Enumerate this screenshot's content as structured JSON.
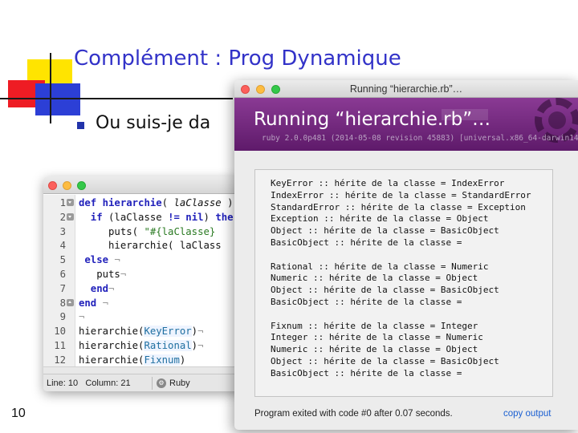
{
  "slide": {
    "title": "Complément : Prog Dynamique",
    "bullet": "Ou suis-je da",
    "page_number": "10",
    "title_color": "#3232c8"
  },
  "editor": {
    "lines": [
      {
        "num": "1",
        "fold": "down",
        "code": [
          {
            "t": "def ",
            "c": "kw"
          },
          {
            "t": "hierarchie",
            "c": "kw"
          },
          {
            "t": "( ",
            "c": ""
          },
          {
            "t": "laClasse",
            "c": "it"
          },
          {
            "t": " )",
            "c": ""
          }
        ]
      },
      {
        "num": "2",
        "fold": "down",
        "code": [
          {
            "t": "  if ",
            "c": "kw"
          },
          {
            "t": "(laClasse ",
            "c": ""
          },
          {
            "t": "!= nil",
            "c": "kw"
          },
          {
            "t": ") ",
            "c": ""
          },
          {
            "t": "the",
            "c": "kw"
          }
        ]
      },
      {
        "num": "3",
        "fold": "",
        "code": [
          {
            "t": "     puts( ",
            "c": ""
          },
          {
            "t": "\"#{laClasse}",
            "c": "str"
          }
        ]
      },
      {
        "num": "4",
        "fold": "",
        "code": [
          {
            "t": "     hierarchie( laClass",
            "c": ""
          }
        ]
      },
      {
        "num": "5",
        "fold": "",
        "code": [
          {
            "t": " else",
            "c": "kw"
          },
          {
            "t": " ¬",
            "c": "inv"
          }
        ]
      },
      {
        "num": "6",
        "fold": "",
        "code": [
          {
            "t": "   puts",
            "c": ""
          },
          {
            "t": "¬",
            "c": "inv"
          }
        ]
      },
      {
        "num": "7",
        "fold": "",
        "code": [
          {
            "t": "  end",
            "c": "kw"
          },
          {
            "t": "¬",
            "c": "inv"
          }
        ]
      },
      {
        "num": "8",
        "fold": "up",
        "code": [
          {
            "t": "end",
            "c": "kw"
          },
          {
            "t": " ¬",
            "c": "inv"
          }
        ]
      },
      {
        "num": "9",
        "fold": "",
        "code": [
          {
            "t": "¬",
            "c": "inv"
          }
        ]
      },
      {
        "num": "10",
        "fold": "",
        "code": [
          {
            "t": "hierarchie(",
            "c": ""
          },
          {
            "t": "KeyError",
            "c": "cls"
          },
          {
            "t": ")",
            "c": ""
          },
          {
            "t": "¬",
            "c": "inv"
          }
        ]
      },
      {
        "num": "11",
        "fold": "",
        "code": [
          {
            "t": "hierarchie(",
            "c": ""
          },
          {
            "t": "Rational",
            "c": "cls"
          },
          {
            "t": ")",
            "c": ""
          },
          {
            "t": "¬",
            "c": "inv"
          }
        ]
      },
      {
        "num": "12",
        "fold": "",
        "code": [
          {
            "t": "hierarchie(",
            "c": ""
          },
          {
            "t": "Fixnum",
            "c": "cls"
          },
          {
            "t": ")",
            "c": ""
          }
        ]
      }
    ],
    "status": {
      "position": "Line: 10   Column: 21",
      "language": "Ruby",
      "language_icon": "cog-icon"
    }
  },
  "runner": {
    "window_title": "Running “hierarchie.rb”…",
    "heading": "Running “hierarchie.rb”…",
    "subtitle": "ruby 2.0.0p481 (2014-05-08 revision 45883) [universal.x86_64-darwin14]",
    "header_color": "#6e2a7a",
    "output_lines": [
      "KeyError :: hérite de la classe = IndexError",
      "IndexError :: hérite de la classe = StandardError",
      "StandardError :: hérite de la classe = Exception",
      "Exception :: hérite de la classe = Object",
      "Object :: hérite de la classe = BasicObject",
      "BasicObject :: hérite de la classe =",
      "",
      "Rational :: hérite de la classe = Numeric",
      "Numeric :: hérite de la classe = Object",
      "Object :: hérite de la classe = BasicObject",
      "BasicObject :: hérite de la classe =",
      "",
      "Fixnum :: hérite de la classe = Integer",
      "Integer :: hérite de la classe = Numeric",
      "Numeric :: hérite de la classe = Object",
      "Object :: hérite de la classe = BasicObject",
      "BasicObject :: hérite de la classe ="
    ],
    "exit_message": "Program exited with code #0 after 0.07 seconds.",
    "copy_output_label": "copy output"
  }
}
